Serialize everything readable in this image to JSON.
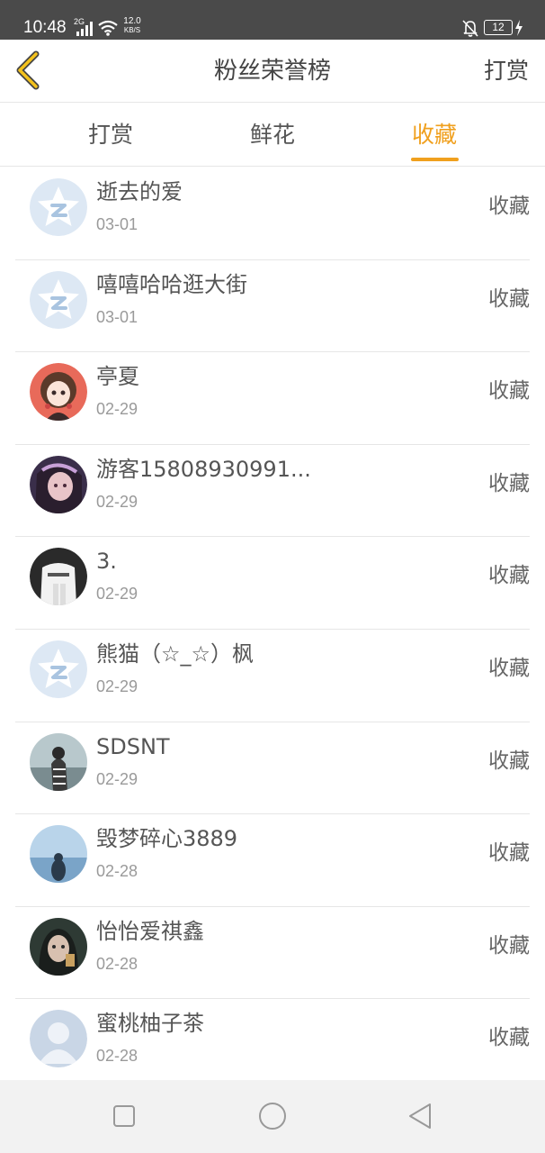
{
  "status_bar": {
    "time": "10:48",
    "network": "2G",
    "speed_value": "12.0",
    "speed_unit": "KB/S",
    "battery": "12"
  },
  "header": {
    "title": "粉丝荣誉榜",
    "action_label": "打赏",
    "back_icon": "chevron-left-icon"
  },
  "tabs": [
    {
      "label": "打赏",
      "active": false
    },
    {
      "label": "鲜花",
      "active": false
    },
    {
      "label": "收藏",
      "active": true
    }
  ],
  "colors": {
    "accent": "#f0a01e",
    "status_bar": "#4a4a4a",
    "text": "#555555",
    "date": "#9a9a9a",
    "divider": "#e6e6e6"
  },
  "fans": [
    {
      "name": "逝去的爱",
      "date": "03-01",
      "action": "收藏",
      "avatar": "default-star-avatar"
    },
    {
      "name": "嘻嘻哈哈逛大街",
      "date": "03-01",
      "action": "收藏",
      "avatar": "default-star-avatar"
    },
    {
      "name": "亭夏",
      "date": "02-29",
      "action": "收藏",
      "avatar": "anime-girl-avatar"
    },
    {
      "name": "游客15808930991...",
      "date": "02-29",
      "action": "收藏",
      "avatar": "girl-photo-avatar"
    },
    {
      "name": "3.",
      "date": "02-29",
      "action": "收藏",
      "avatar": "sweater-photo-avatar"
    },
    {
      "name": "熊猫（☆_☆）枫",
      "date": "02-29",
      "action": "收藏",
      "avatar": "default-star-avatar"
    },
    {
      "name": "SDSNT",
      "date": "02-29",
      "action": "收藏",
      "avatar": "beach-person-avatar"
    },
    {
      "name": "毁梦碎心3889",
      "date": "02-28",
      "action": "收藏",
      "avatar": "sea-silhouette-avatar"
    },
    {
      "name": "怡怡爱祺鑫",
      "date": "02-28",
      "action": "收藏",
      "avatar": "dark-portrait-avatar"
    },
    {
      "name": "蜜桃柚子茶",
      "date": "02-28",
      "action": "收藏",
      "avatar": "default-person-avatar"
    }
  ],
  "nav": {
    "recents_icon": "square-icon",
    "home_icon": "circle-icon",
    "back_icon": "triangle-back-icon"
  }
}
